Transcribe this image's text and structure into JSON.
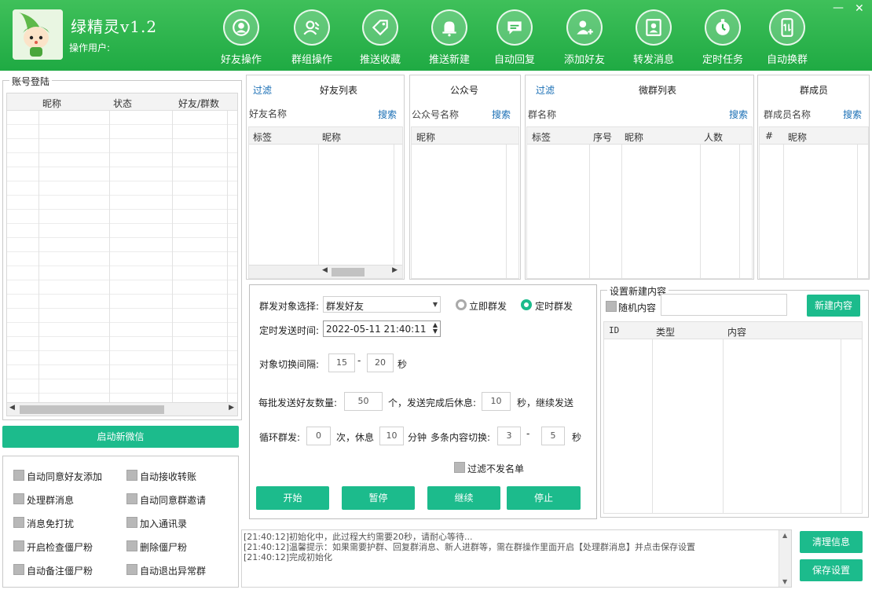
{
  "header": {
    "title": "绿精灵v1.2",
    "operator_label": "操作用户:",
    "nav": [
      {
        "label": "好友操作",
        "icon": "person-circle-icon"
      },
      {
        "label": "群组操作",
        "icon": "group-person-icon"
      },
      {
        "label": "推送收藏",
        "icon": "tag-icon"
      },
      {
        "label": "推送新建",
        "icon": "bell-icon"
      },
      {
        "label": "自动回复",
        "icon": "chat-bubble-icon"
      },
      {
        "label": "添加好友",
        "icon": "add-user-icon"
      },
      {
        "label": "转发消息",
        "icon": "contact-card-icon"
      },
      {
        "label": "定时任务",
        "icon": "timer-icon"
      },
      {
        "label": "自动换群",
        "icon": "phone-swap-icon"
      }
    ],
    "minimize": "—",
    "close": "✕"
  },
  "accounts": {
    "title": "账号登陆",
    "columns": [
      "昵称",
      "状态",
      "好友/群数"
    ],
    "start_button": "启动新微信"
  },
  "options": [
    {
      "label": "自动同意好友添加",
      "checked": false
    },
    {
      "label": "自动接收转账",
      "checked": false
    },
    {
      "label": "处理群消息",
      "checked": false
    },
    {
      "label": "自动同意群邀请",
      "checked": false
    },
    {
      "label": "消息免打扰",
      "checked": false
    },
    {
      "label": "加入通讯录",
      "checked": false
    },
    {
      "label": "开启检查僵尸粉",
      "checked": false
    },
    {
      "label": "删除僵尸粉",
      "checked": false
    },
    {
      "label": "自动备注僵尸粉",
      "checked": false
    },
    {
      "label": "自动退出异常群",
      "checked": false
    }
  ],
  "friends": {
    "filter": "过滤",
    "title": "好友列表",
    "name_label": "好友名称",
    "search": "搜索",
    "columns": [
      "标签",
      "昵称"
    ]
  },
  "official": {
    "title": "公众号",
    "name_label": "公众号名称",
    "search": "搜索",
    "columns": [
      "昵称"
    ]
  },
  "groups": {
    "filter": "过滤",
    "title": "微群列表",
    "name_label": "群名称",
    "search": "搜索",
    "columns": [
      "标签",
      "序号",
      "昵称",
      "人数"
    ]
  },
  "members": {
    "title": "群成员",
    "name_label": "群成员名称",
    "search": "搜索",
    "columns": [
      "#",
      "昵称"
    ]
  },
  "send": {
    "target_label": "群发对象选择:",
    "target_value": "群发好友",
    "radio_now": "立即群发",
    "radio_timed": "定时群发",
    "timed_selected": true,
    "time_label": "定时发送时间:",
    "time_value": "2022-05-11 21:40:11",
    "interval_label": "对象切换间隔:",
    "interval_min": "15",
    "interval_dash": "-",
    "interval_max": "20",
    "sec": "秒",
    "batch_label": "每批发送好友数量:",
    "batch_value": "50",
    "batch_mid": "个，发送完成后休息:",
    "rest_value": "10",
    "batch_end": "秒，继续发送",
    "loop_label": "循环群发:",
    "loop_value": "0",
    "loop_mid": "次，休息",
    "loop_rest": "10",
    "loop_min": "分钟",
    "switch_label": "多条内容切换:",
    "switch_min": "3",
    "switch_dash": "-",
    "switch_max": "5",
    "switch_sec": "秒",
    "filter_label": "过滤不发名单",
    "buttons": [
      "开始",
      "暂停",
      "继续",
      "停止"
    ]
  },
  "content": {
    "title": "设置新建内容",
    "random_label": "随机内容",
    "new_button": "新建内容",
    "columns": [
      "ID",
      "类型",
      "内容"
    ]
  },
  "log": {
    "lines": [
      "[21:40:12]初始化中，此过程大约需要20秒，请耐心等待...",
      "[21:40:12]温馨提示：如果需要护群、回复群消息、新人进群等，需在群操作里面开启【处理群消息】并点击保存设置",
      "[21:40:12]完成初始化"
    ],
    "clear_button": "清理信息",
    "save_button": "保存设置"
  },
  "colors": {
    "header": "#2cb54b",
    "button": "#1cbb8c",
    "link": "#1a6fb5"
  }
}
